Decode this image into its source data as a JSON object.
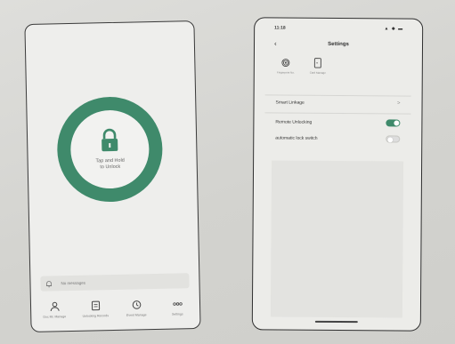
{
  "left_screen": {
    "lock_prompt": "Tap and Hold\nto Unlock",
    "message_bar": {
      "text": "No messages",
      "icon": "bell-icon"
    },
    "nav": [
      {
        "label": "Doc Mr. Manage",
        "icon": "user-icon"
      },
      {
        "label": "Unlocking Records",
        "icon": "records-icon"
      },
      {
        "label": "Event Manage",
        "icon": "event-icon"
      },
      {
        "label": "Settings",
        "icon": "more-icon"
      }
    ],
    "accent_color": "#3f8a6b"
  },
  "right_screen": {
    "status": {
      "time": "11:18",
      "icons": "▲ ◆ ▬"
    },
    "header": {
      "title": "Settings",
      "back_icon": "chevron-left-icon"
    },
    "quick_actions": [
      {
        "label": "Fingerprint No.",
        "icon": "fingerprint-icon"
      },
      {
        "label": "Card Manage",
        "icon": "card-icon"
      }
    ],
    "rows": [
      {
        "label": "Smart Linkage",
        "control": "chevron",
        "value": ">"
      },
      {
        "label": "Remote Unlocking",
        "control": "toggle",
        "on": true
      },
      {
        "label": "automatic lock switch",
        "control": "toggle",
        "on": false
      }
    ],
    "accent_color": "#3f8a6b"
  }
}
